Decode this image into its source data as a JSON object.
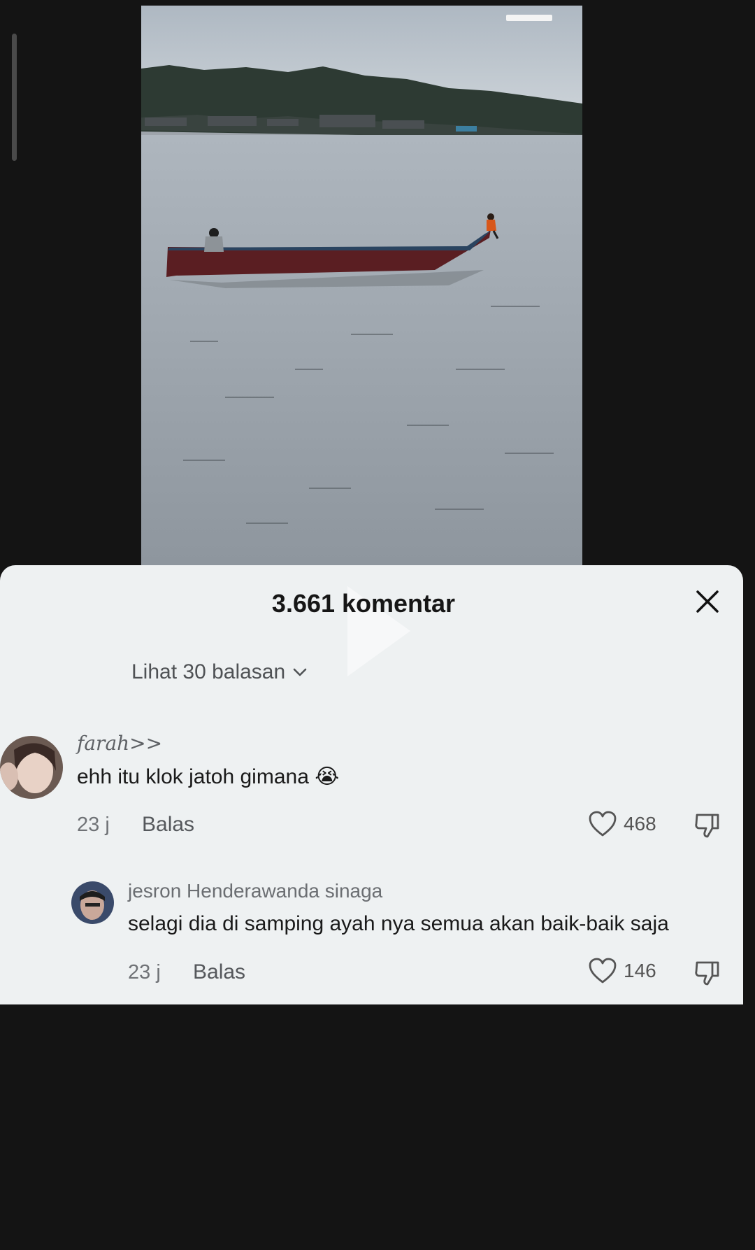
{
  "comments_sheet": {
    "title": "3.661 komentar",
    "view_replies_label": "Lihat 30 balasan",
    "comments": [
      {
        "username": "farah>>",
        "text": "ehh itu klok jatoh gimana 😭",
        "time": "23 j",
        "reply_label": "Balas",
        "likes": "468"
      },
      {
        "username": "jesron Henderawanda sinaga",
        "text": "selagi dia di samping ayah nya semua akan baik-baik saja",
        "time": "23 j",
        "reply_label": "Balas",
        "likes": "146"
      }
    ]
  },
  "icons": {
    "close": "close-icon",
    "chevron": "chevron-down-icon",
    "like": "heart-icon",
    "dislike": "thumbs-down-icon",
    "play": "play-icon"
  },
  "colors": {
    "background": "#141414",
    "sheet": "#eef1f2",
    "title_text": "#161616",
    "secondary_text": "#6f7276"
  }
}
